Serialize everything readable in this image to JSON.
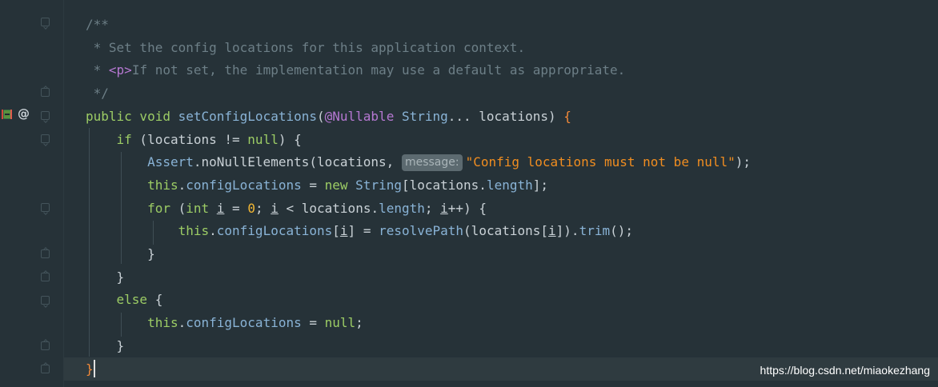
{
  "editor": {
    "lines": [
      [
        {
          "t": "/**",
          "c": "comment"
        }
      ],
      [
        {
          "t": " * Set the config locations for this application context.",
          "c": "comment"
        }
      ],
      [
        {
          "t": " * ",
          "c": "comment"
        },
        {
          "t": "<p>",
          "c": "tag"
        },
        {
          "t": "If not set, the implementation may use a default as appropriate.",
          "c": "comment"
        }
      ],
      [
        {
          "t": " */",
          "c": "comment"
        }
      ],
      [
        {
          "t": "public void ",
          "c": "kw"
        },
        {
          "t": "setConfigLocations",
          "c": "fn"
        },
        {
          "t": "(",
          "c": ""
        },
        {
          "t": "@Nullable ",
          "c": "anno"
        },
        {
          "t": "String",
          "c": "type"
        },
        {
          "t": "... locations) ",
          "c": ""
        },
        {
          "t": "{",
          "c": "brace"
        }
      ],
      [
        {
          "t": "    ",
          "c": ""
        },
        {
          "t": "if",
          "c": "kw"
        },
        {
          "t": " (locations != ",
          "c": ""
        },
        {
          "t": "null",
          "c": "null"
        },
        {
          "t": ") {",
          "c": ""
        }
      ],
      [
        {
          "t": "        ",
          "c": ""
        },
        {
          "t": "Assert",
          "c": "type"
        },
        {
          "t": ".noNullElements(locations, ",
          "c": ""
        },
        {
          "t": "message:",
          "c": "hint"
        },
        {
          "t": "\"Config locations must not be null\"",
          "c": "str"
        },
        {
          "t": ");",
          "c": ""
        }
      ],
      [
        {
          "t": "        ",
          "c": ""
        },
        {
          "t": "this",
          "c": "kw"
        },
        {
          "t": ".",
          "c": ""
        },
        {
          "t": "configLocations",
          "c": "field"
        },
        {
          "t": " = ",
          "c": ""
        },
        {
          "t": "new ",
          "c": "kw"
        },
        {
          "t": "String",
          "c": "type"
        },
        {
          "t": "[locations.",
          "c": ""
        },
        {
          "t": "length",
          "c": "field"
        },
        {
          "t": "];",
          "c": ""
        }
      ],
      [
        {
          "t": "        ",
          "c": ""
        },
        {
          "t": "for",
          "c": "kw"
        },
        {
          "t": " (",
          "c": ""
        },
        {
          "t": "int ",
          "c": "kw"
        },
        {
          "t": "i",
          "c": "u"
        },
        {
          "t": " = ",
          "c": ""
        },
        {
          "t": "0",
          "c": "num"
        },
        {
          "t": "; ",
          "c": ""
        },
        {
          "t": "i",
          "c": "u"
        },
        {
          "t": " < locations.",
          "c": ""
        },
        {
          "t": "length",
          "c": "field"
        },
        {
          "t": "; ",
          "c": ""
        },
        {
          "t": "i",
          "c": "u"
        },
        {
          "t": "++) {",
          "c": ""
        }
      ],
      [
        {
          "t": "            ",
          "c": ""
        },
        {
          "t": "this",
          "c": "kw"
        },
        {
          "t": ".",
          "c": ""
        },
        {
          "t": "configLocations",
          "c": "field"
        },
        {
          "t": "[",
          "c": ""
        },
        {
          "t": "i",
          "c": "u"
        },
        {
          "t": "] = ",
          "c": ""
        },
        {
          "t": "resolvePath",
          "c": "fn"
        },
        {
          "t": "(locations[",
          "c": ""
        },
        {
          "t": "i",
          "c": "u"
        },
        {
          "t": "]).",
          "c": ""
        },
        {
          "t": "trim",
          "c": "fn"
        },
        {
          "t": "();",
          "c": ""
        }
      ],
      [
        {
          "t": "        }",
          "c": ""
        }
      ],
      [
        {
          "t": "    }",
          "c": ""
        }
      ],
      [
        {
          "t": "    ",
          "c": ""
        },
        {
          "t": "else",
          "c": "kw"
        },
        {
          "t": " {",
          "c": ""
        }
      ],
      [
        {
          "t": "        ",
          "c": ""
        },
        {
          "t": "this",
          "c": "kw"
        },
        {
          "t": ".",
          "c": ""
        },
        {
          "t": "configLocations",
          "c": "field"
        },
        {
          "t": " = ",
          "c": ""
        },
        {
          "t": "null",
          "c": "null"
        },
        {
          "t": ";",
          "c": ""
        }
      ],
      [
        {
          "t": "    }",
          "c": ""
        }
      ],
      [
        {
          "t": "}",
          "c": "brace"
        },
        {
          "t": "",
          "c": "caret"
        }
      ]
    ]
  },
  "gutter": {
    "icons": [
      "override-marker-icon",
      "annotation-at-icon"
    ],
    "at_symbol": "@"
  },
  "watermark": {
    "text": "https://blog.csdn.net/miaokezhang"
  }
}
